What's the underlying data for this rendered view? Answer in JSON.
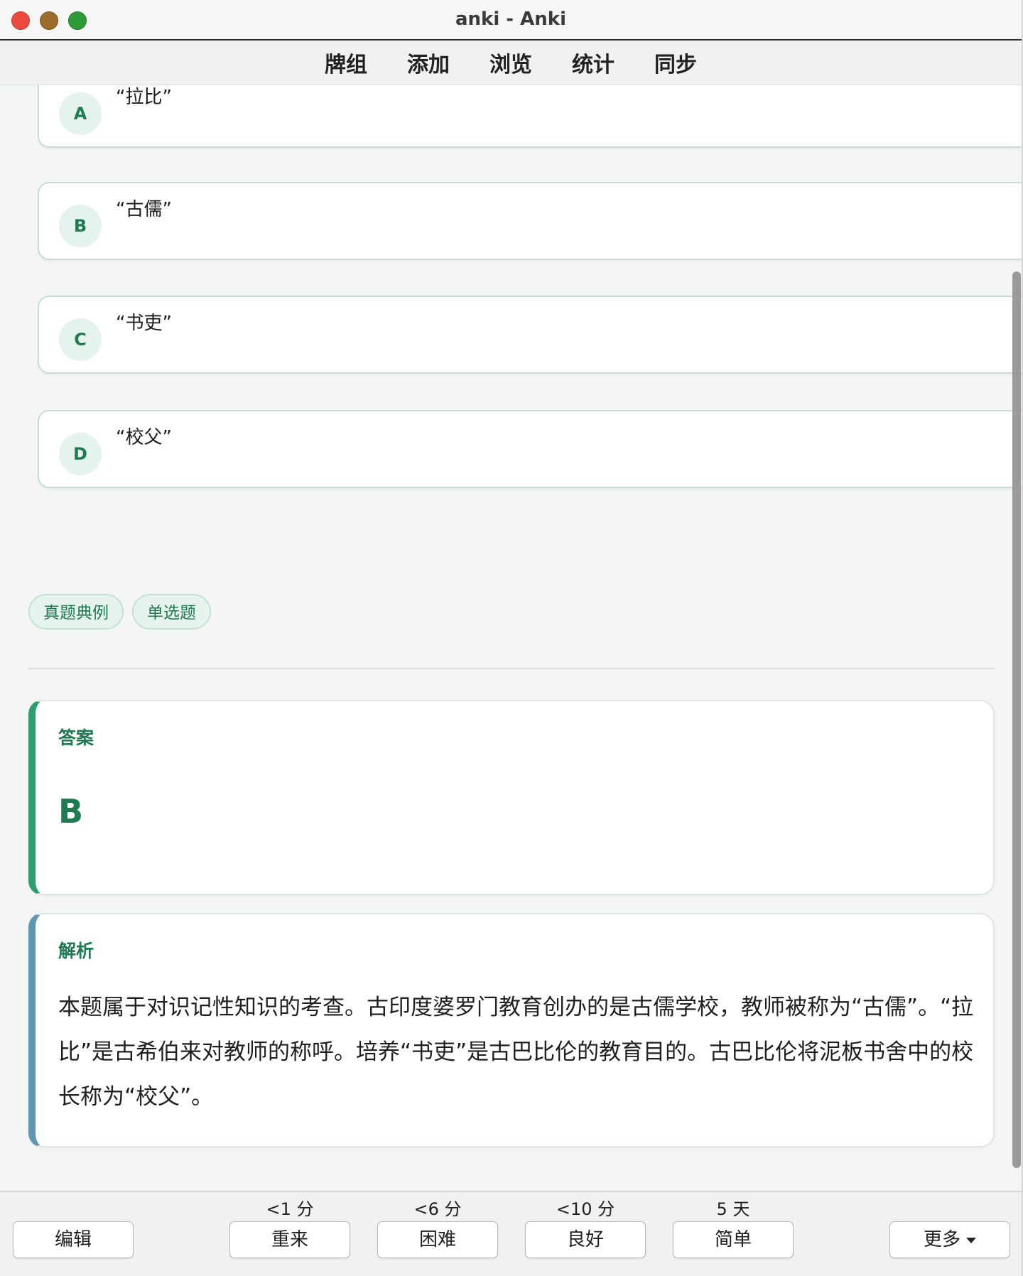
{
  "window": {
    "title": "anki - Anki"
  },
  "toolbar": {
    "items": [
      "牌组",
      "添加",
      "浏览",
      "统计",
      "同步"
    ]
  },
  "question": {
    "options": [
      {
        "letter": "A",
        "text": "“拉比”"
      },
      {
        "letter": "B",
        "text": "“古儒”"
      },
      {
        "letter": "C",
        "text": "“书吏”"
      },
      {
        "letter": "D",
        "text": "“校父”"
      }
    ],
    "tags": [
      "真题典例",
      "单选题"
    ]
  },
  "answer": {
    "label": "答案",
    "value": "B"
  },
  "analysis": {
    "label": "解析",
    "text": "本题属于对识记性知识的考查。古印度婆罗门教育创办的是古儒学校，教师被称为“古儒”。“拉比”是古希伯来对教师的称呼。培养“书吏”是古巴比伦的教育目的。古巴比伦将泥板书舍中的校长称为“校父”。"
  },
  "review_bar": {
    "edit_label": "编辑",
    "more_label": "更多",
    "buttons": [
      {
        "label": "重来",
        "interval": "<1 分"
      },
      {
        "label": "困难",
        "interval": "<6 分"
      },
      {
        "label": "良好",
        "interval": "<10 分"
      },
      {
        "label": "简单",
        "interval": "5 天"
      }
    ]
  }
}
